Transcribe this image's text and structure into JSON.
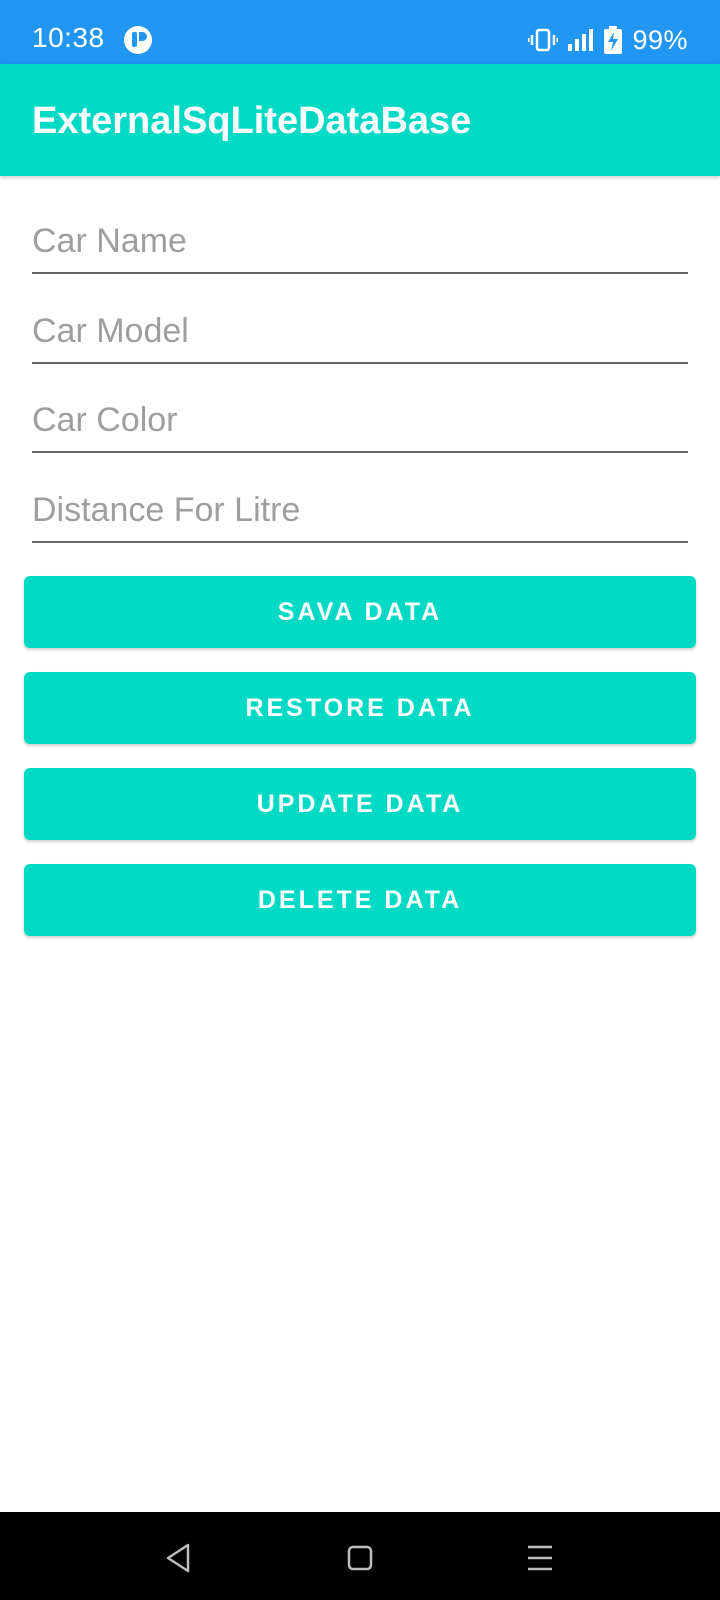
{
  "status_bar": {
    "time": "10:38",
    "battery_percent": "99%",
    "icons": [
      "app-notification-icon",
      "vibrate-icon",
      "signal-icon",
      "battery-charging-icon"
    ]
  },
  "app_bar": {
    "title": "ExternalSqLiteDataBase"
  },
  "form": {
    "car_name_placeholder": "Car Name",
    "car_model_placeholder": "Car Model",
    "car_color_placeholder": "Car Color",
    "distance_placeholder": "Distance For Litre"
  },
  "buttons": {
    "save": "SAVA DATA",
    "restore": "RESTORE DATA",
    "update": "UPDATE DATA",
    "delete": "DELETE DATA"
  },
  "nav_bar": {
    "icons": [
      "back-icon",
      "home-icon",
      "recents-icon"
    ]
  },
  "colors": {
    "status_bar": "#2196f3",
    "accent": "#03dac5",
    "nav_bar": "#000000"
  }
}
